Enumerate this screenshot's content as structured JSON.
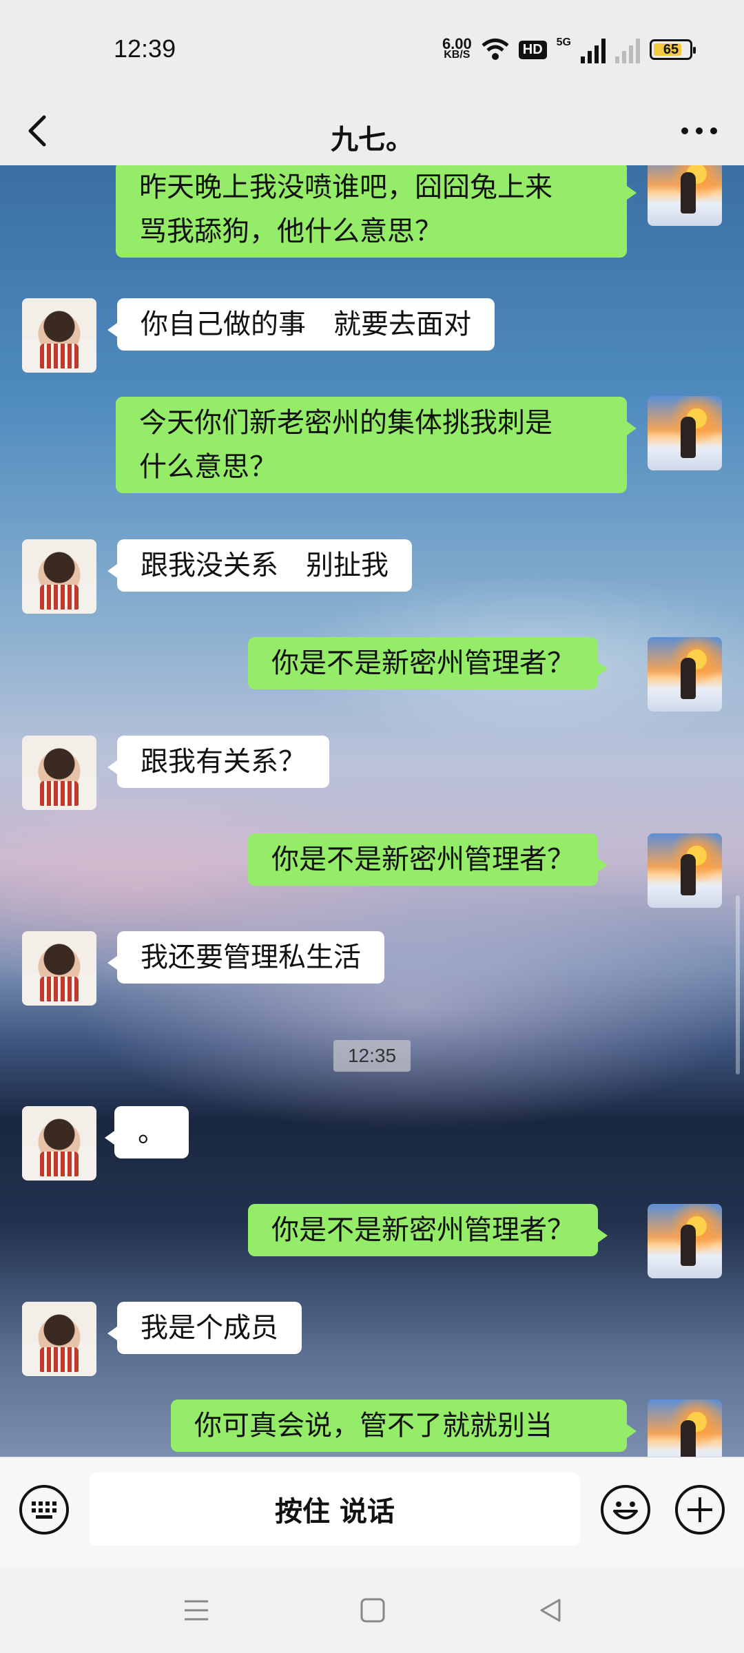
{
  "status_bar": {
    "time": "12:39",
    "net_speed_value": "6.00",
    "net_speed_unit": "KB/S",
    "hd_label": "HD",
    "network_type": "5G",
    "battery_level": "65"
  },
  "header": {
    "title": "九七。",
    "back_icon": "chevron-left-icon",
    "more_icon": "more-dots-icon"
  },
  "messages": [
    {
      "from": "self",
      "text": "昨天晚上我没喷谁吧，囧囧兔上来\n骂我舔狗，他什么意思？"
    },
    {
      "from": "other",
      "text": "你自己做的事　就要去面对"
    },
    {
      "from": "self",
      "text": "今天你们新老密州的集体挑我刺是\n什么意思？"
    },
    {
      "from": "other",
      "text": "跟我没关系　别扯我"
    },
    {
      "from": "self",
      "text": "你是不是新密州管理者？"
    },
    {
      "from": "other",
      "text": "跟我有关系？"
    },
    {
      "from": "self",
      "text": "你是不是新密州管理者？"
    },
    {
      "from": "other",
      "text": "我还要管理私生活"
    },
    {
      "from": "other",
      "text": "。"
    },
    {
      "from": "self",
      "text": "你是不是新密州管理者？"
    },
    {
      "from": "other",
      "text": "我是个成员"
    },
    {
      "from": "self",
      "text": "你可真会说，管不了就就别当"
    }
  ],
  "timestamp": "12:35",
  "input_bar": {
    "hold_to_talk": "按住 说话",
    "keyboard_icon": "keyboard-icon",
    "emoji_icon": "emoji-icon",
    "plus_icon": "plus-icon"
  },
  "nav_bar": {
    "menu_icon": "menu-icon",
    "home_icon": "home-square-icon",
    "back_icon": "back-triangle-icon"
  },
  "colors": {
    "self_bubble": "#95ec69",
    "other_bubble": "#ffffff",
    "bar_background": "#ededed"
  }
}
